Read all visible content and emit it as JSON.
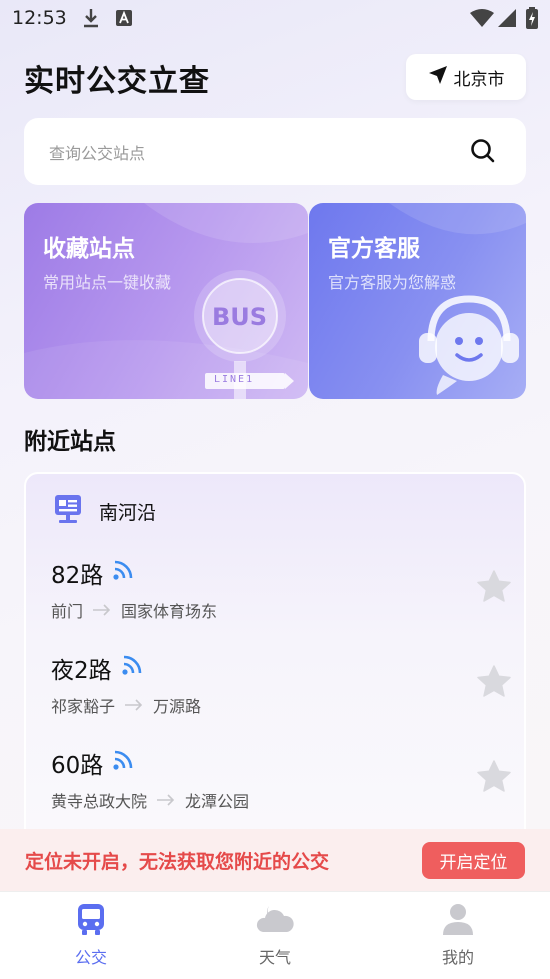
{
  "status_bar": {
    "time": "12:53"
  },
  "header": {
    "title": "实时公交立查",
    "city": "北京市"
  },
  "search": {
    "placeholder": "查询公交站点"
  },
  "cards": [
    {
      "title": "收藏站点",
      "subtitle": "常用站点一键收藏",
      "badge_text": "BUS",
      "sign_text": "LINE1"
    },
    {
      "title": "官方客服",
      "subtitle": "官方客服为您解惑"
    }
  ],
  "nearby": {
    "section_title": "附近站点",
    "stop_name": "南河沿",
    "routes": [
      {
        "name": "82路",
        "from": "前门",
        "to": "国家体育场东"
      },
      {
        "name": "夜2路",
        "from": "祁家豁子",
        "to": "万源路"
      },
      {
        "name": "60路",
        "from": "黄寺总政大院",
        "to": "龙潭公园"
      }
    ]
  },
  "alert": {
    "message": "定位未开启，无法获取您附近的公交",
    "button": "开启定位"
  },
  "tabs": [
    {
      "label": "公交",
      "icon": "bus-icon",
      "active": true
    },
    {
      "label": "天气",
      "icon": "weather-icon",
      "active": false
    },
    {
      "label": "我的",
      "icon": "profile-icon",
      "active": false
    }
  ],
  "colors": {
    "accent": "#5b6ef0",
    "alert_text": "#e54a4a",
    "alert_button": "#ef5e5e",
    "signal": "#3b8cf0",
    "star": "#d9d9de"
  }
}
